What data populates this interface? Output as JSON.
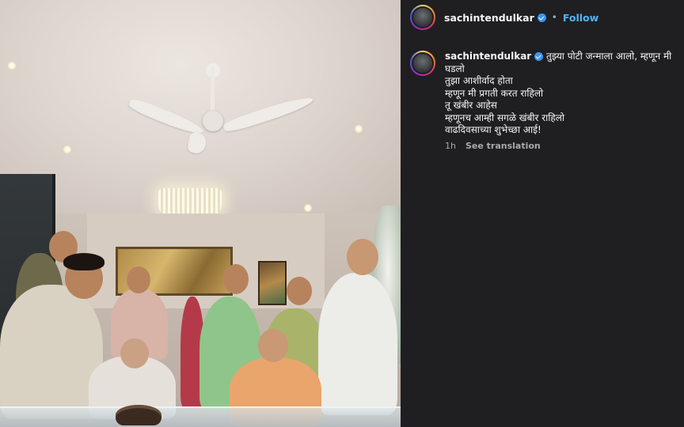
{
  "post": {
    "image_alt": "Family birthday celebration photo",
    "header": {
      "username": "sachintendulkar",
      "separator": "•",
      "follow_label": "Follow",
      "avatar_icon": "profile-avatar-icon",
      "verified_icon": "verified-badge-icon"
    },
    "caption": {
      "username": "sachintendulkar",
      "lines": [
        "तुझ्या पोटी जन्माला आलो, म्हणून मी घडलो",
        "तुझा आशीर्वाद होता",
        "म्हणून मी प्रगती करत राहिलो",
        "तू खंबीर आहेस",
        "म्हणूनच आम्ही सगळे खंबीर राहिलो",
        "वाढदिवसाच्या शुभेच्छा आई!"
      ],
      "time": "1h",
      "see_translation": "See translation"
    },
    "colors": {
      "panel_bg": "#1f1f22",
      "follow": "#4cb5f9",
      "verified": "#3897f0"
    }
  }
}
